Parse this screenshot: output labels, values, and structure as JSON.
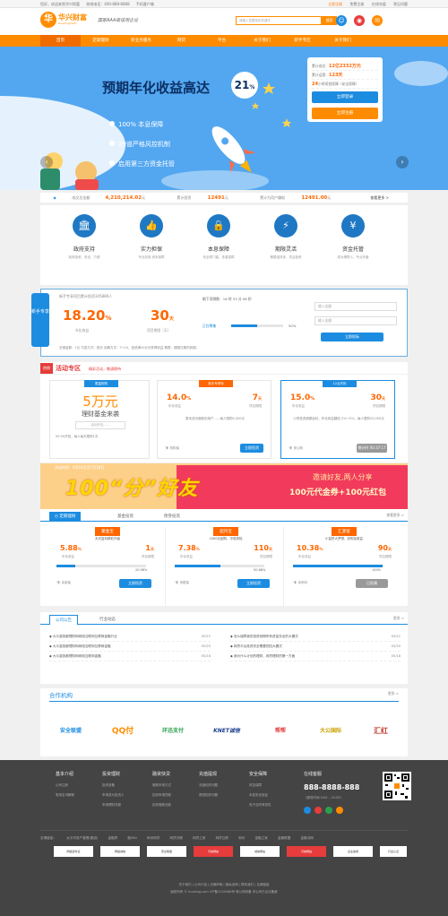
{
  "topbar": {
    "welcome": "您好，欢迎来到华兴财富",
    "hotline": "热线电话：400-888-8888",
    "mobile": "手机客户端",
    "links": [
      "立即注册",
      "免费注册",
      "在线充值",
      "常见问题"
    ]
  },
  "header": {
    "logo_char": "华",
    "logo_name": "华兴财富",
    "logo_pinyin": "HuaXingCaiFu",
    "slogan": "国家AAA级信用企业",
    "search_placeholder": "请输入您要找的关键字",
    "search_button": "搜索"
  },
  "nav": [
    "首页",
    "定期理财",
    "新业务服务",
    "网贷",
    "平台",
    "关于我们",
    "新手专区",
    "关于我们"
  ],
  "banner": {
    "title": "预期年化收益高达",
    "percent": "21",
    "percent_unit": "%",
    "points": [
      "100% 本息保障",
      "29道严格风控机制",
      "启用第三方资金托管"
    ],
    "card": {
      "total_label": "累计成交：",
      "total_value": "12亿2332万元",
      "days_label": "累计运营：",
      "days_value": "123天",
      "safe_prefix": "24",
      "safe_text": "小时续投保障（安全保障）",
      "login_button": "立即登录",
      "register_button": "立即注册"
    },
    "arrow_left": "‹",
    "arrow_right": "›"
  },
  "stats": {
    "total_label": "成交总金额",
    "total_value": "4,210,214.02",
    "total_unit": "元",
    "invest_label": "累计投资",
    "invest_value": "12491",
    "invest_unit": "元",
    "earn_label": "累计为用户赚取",
    "earn_value": "12491.00",
    "earn_unit": "元",
    "more": "查看更多 >"
  },
  "features": [
    {
      "icon": "government-icon",
      "glyph": "🏛",
      "title": "政府支持",
      "desc": "政府投资、安全、方便"
    },
    {
      "icon": "guarantee-icon",
      "glyph": "👍",
      "title": "实力担保",
      "desc": "专业担保 资本保障"
    },
    {
      "icon": "lock-icon",
      "glyph": "🔒",
      "title": "本息保障",
      "desc": "安全零门槛，多重保障"
    },
    {
      "icon": "lightning-icon",
      "glyph": "⚡",
      "title": "期限灵活",
      "desc": "期限选择多，灵活投资"
    },
    {
      "icon": "money-bag-icon",
      "glyph": "¥",
      "title": "资金托管",
      "desc": "成为理财人，专业托管"
    }
  ],
  "newbie": {
    "tag": "新手专享",
    "title": "新手专享项目累计投资345889人",
    "rate": "18.20",
    "rate_unit": "%",
    "rate_label": "年化收益",
    "period": "30",
    "period_unit": "天",
    "period_label": "项目期限（天）",
    "countdown": "剩下项倒数：16 时 53 分 08 秒",
    "status": "正在筹集",
    "progress": 50,
    "progress_text": "50%",
    "amount_placeholder": "输入金额",
    "balance_placeholder": "输入金额",
    "button": "立即投标",
    "footer": "总借金额：1元    付息方式：按月    到期方式：T+10，投资满30元可获得收益  期限：期限日期内到期。"
  },
  "activity": {
    "badge": "热销",
    "title": "活动专区",
    "subtitle": "精彩活动，敬请期待",
    "feature_card": {
      "tag": "限量抢购",
      "amount": "5万元",
      "name": "理财基金来袭",
      "desc": "活动开启……",
      "time": "09:30开抢，每人每天限购1次"
    },
    "cards": [
      {
        "tag": "新手专享标",
        "rate": "14.0",
        "unit": "%",
        "days": "7",
        "days_unit": "天",
        "rate_label": "年化收益",
        "days_label": "项目期限",
        "desc": "周末成功借款的用户……每人限购5,000元",
        "guarantee": "机构保",
        "button": "立即投资",
        "button_style": "blue"
      },
      {
        "tag": "12点开抢",
        "rate": "15.0",
        "unit": "%",
        "days": "30",
        "days_unit": "天",
        "rate_label": "年化收益",
        "days_label": "项目期限",
        "desc": "小饼投资超额返利，年化收益翻倍 2%～5%，每人限购20,000元",
        "guarantee": "安心购",
        "button": "倒计时 00:37:17",
        "button_style": "gray"
      }
    ]
  },
  "promo": {
    "date": "活动时间：6月16日至7月18日",
    "title": "100“分”好友",
    "line1": "邀请好友,两人分享",
    "line2": "100元代金券+100元红包"
  },
  "products": {
    "tabs": [
      "定期理财",
      "基金投资",
      "债券投资"
    ],
    "more": "查看更多 >",
    "items": [
      {
        "name": "聚金宝",
        "tagline": "天天复利精彩升级",
        "rate": "5.88",
        "days": "1",
        "rate_label": "年化收益",
        "days_label": "项目期限",
        "progress": 20.98,
        "progress_text": "20.98%",
        "guarantee": "买卖保",
        "button": "立即投资",
        "button_style": "blue"
      },
      {
        "name": "超月宝",
        "tagline": "1000元起购，中低风险",
        "rate": "7.38",
        "days": "110",
        "rate_label": "年化收益",
        "days_label": "项目期限",
        "progress": 50.68,
        "progress_text": "50.68%",
        "guarantee": "安稳保",
        "button": "立即投资",
        "button_style": "blue"
      },
      {
        "name": "汇源富",
        "tagline": "小富终大梦想，收购加收益",
        "rate": "10.38",
        "days": "90",
        "rate_label": "年化收益",
        "days_label": "项目期限",
        "progress": 100,
        "progress_text": "100%",
        "guarantee": "本系利",
        "button": "已投满",
        "button_style": "gray"
      }
    ]
  },
  "news": {
    "tabs": [
      "公司公告",
      "行业动态"
    ],
    "more": "更多 >",
    "left": [
      {
        "text": "大众富钱都理财网网络互联网互联网金融行业",
        "date": "05/22"
      },
      {
        "text": "大众富钱都理财网网络互联网互联网金融",
        "date": "05/20"
      },
      {
        "text": "大众富钱都理财网网络互联网金融",
        "date": "05/18"
      }
    ],
    "right": [
      {
        "text": "怎么保障我的投资到期所有资金安全的大模式",
        "date": "05/21"
      },
      {
        "text": "网贷平台投资安全需要的四大模式",
        "date": "05/20"
      },
      {
        "text": "我为什么计划的理财，网贷理财的第一方面",
        "date": "05/18"
      }
    ]
  },
  "partners": {
    "title": "合作机构",
    "more": "更多 >",
    "items": [
      "安全联盟",
      "QQ付",
      "环迅支付",
      "KNET诚信",
      "帮帮",
      "大公国际",
      "汇红"
    ]
  },
  "footer": {
    "cols": [
      {
        "title": "基本介绍",
        "items": [
          "公司注册",
          "常用名词解释"
        ]
      },
      {
        "title": "投资理财",
        "items": [
          "投资准备",
          "申请成为投资人",
          "申请理财流程"
        ]
      },
      {
        "title": "融资快贷",
        "items": [
          "借款申请方式",
          "如何申请贷款",
          "如何借款还款"
        ]
      },
      {
        "title": "充值提现",
        "items": [
          "充值相关问题",
          "提现相关问题"
        ]
      },
      {
        "title": "安全保障",
        "items": [
          "风控保障",
          "本息安全保证",
          "电子合同有效性"
        ]
      }
    ],
    "service_title": "在线客服",
    "phone": "888-8888-888",
    "service_hours": "（服务时间 9:00 – 22:00）",
    "links_label": "友情链接：",
    "links": [
      "太平洋资产管理(集团)",
      "金融界",
      "融360",
      "和讯网贷",
      "网贷天眼",
      "网贷之家",
      "网贷互联",
      "和讯",
      "金融之家",
      "金融联盟",
      "金融诗网"
    ],
    "certs": [
      "网络身份证",
      "网络诚信",
      "安全联盟",
      "可信网站",
      "诚信网站",
      "可信网站",
      "企业信用",
      "行业认证"
    ],
    "bottom_links": "关于我们 | 公司介绍 | 法律声明 | 隐私说明 | 联系我们 | 友情链接",
    "copyright": "版权所有 © huaxing.com  ICP备1234568号  粤公网安备  本公司已合法备案"
  },
  "colors": {
    "brand": "#ff8c00",
    "accent_blue": "#1c8ce0",
    "banner_bg": "#53a7f0",
    "footer_bg": "#444444",
    "highlight": "#ff6600"
  }
}
